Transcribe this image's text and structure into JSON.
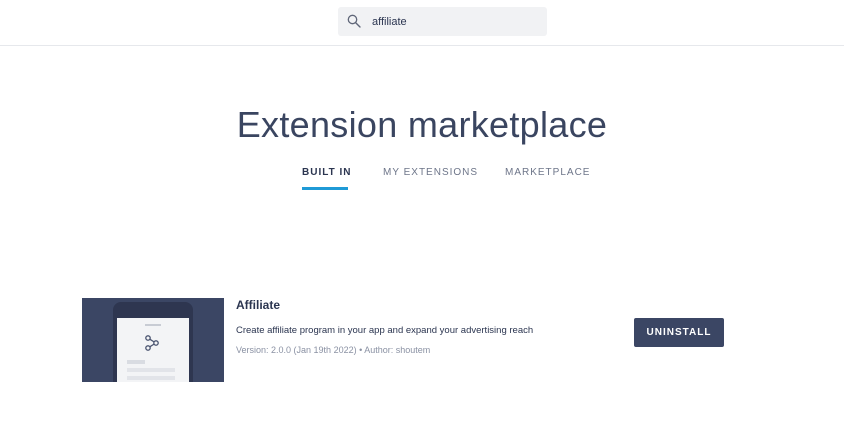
{
  "search": {
    "value": "affiliate",
    "icon": "search-icon"
  },
  "page": {
    "title": "Extension marketplace"
  },
  "tabs": [
    {
      "label": "BUILT IN",
      "active": true
    },
    {
      "label": "MY EXTENSIONS",
      "active": false
    },
    {
      "label": "MARKETPLACE",
      "active": false
    }
  ],
  "extension": {
    "name": "Affiliate",
    "description": "Create affiliate program in your app and expand your advertising reach",
    "meta": "Version: 2.0.0 (Jan 19th 2022) • Author: shoutem",
    "action_label": "UNINSTALL",
    "thumbnail_icon": "affiliate-network-icon"
  },
  "colors": {
    "accent": "#1f9ad6",
    "primary_dark": "#3b4664",
    "text": "#2b3550",
    "muted": "#8a91a3"
  }
}
